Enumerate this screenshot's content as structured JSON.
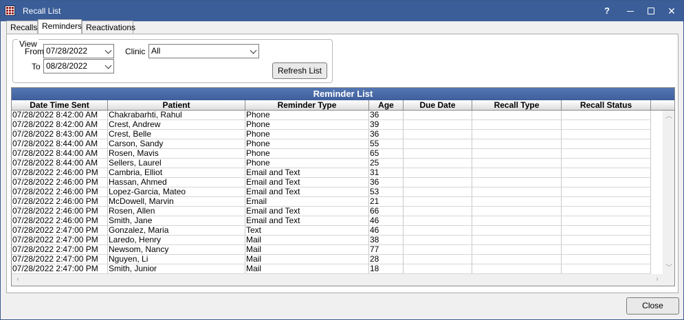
{
  "window": {
    "title": "Recall List",
    "help_label": "?"
  },
  "tabs": [
    {
      "label": "Recalls"
    },
    {
      "label": "Reminders"
    },
    {
      "label": "Reactivations"
    }
  ],
  "view": {
    "legend": "View",
    "from_label": "From",
    "from_value": "07/28/2022",
    "to_label": "To",
    "to_value": "08/28/2022",
    "clinic_label": "Clinic",
    "clinic_value": "All",
    "refresh_label": "Refresh List"
  },
  "grid": {
    "title": "Reminder List",
    "columns": [
      "Date Time Sent",
      "Patient",
      "Reminder Type",
      "Age",
      "Due Date",
      "Recall Type",
      "Recall Status"
    ],
    "rows": [
      [
        "07/28/2022 8:42:00 AM",
        "Chakrabarhti, Rahul",
        "Phone",
        "36",
        "",
        "",
        ""
      ],
      [
        "07/28/2022 8:42:00 AM",
        "Crest, Andrew",
        "Phone",
        "39",
        "",
        "",
        ""
      ],
      [
        "07/28/2022 8:43:00 AM",
        "Crest, Belle",
        "Phone",
        "36",
        "",
        "",
        ""
      ],
      [
        "07/28/2022 8:44:00 AM",
        "Carson, Sandy",
        "Phone",
        "55",
        "",
        "",
        ""
      ],
      [
        "07/28/2022 8:44:00 AM",
        "Rosen, Mavis",
        "Phone",
        "65",
        "",
        "",
        ""
      ],
      [
        "07/28/2022 8:44:00 AM",
        "Sellers, Laurel",
        "Phone",
        "25",
        "",
        "",
        ""
      ],
      [
        "07/28/2022 2:46:00 PM",
        "Cambria, Elliot",
        "Email and Text",
        "31",
        "",
        "",
        ""
      ],
      [
        "07/28/2022 2:46:00 PM",
        "Hassan, Ahmed",
        "Email and Text",
        "36",
        "",
        "",
        ""
      ],
      [
        "07/28/2022 2:46:00 PM",
        "Lopez-Garcia, Mateo",
        "Email and Text",
        "53",
        "",
        "",
        ""
      ],
      [
        "07/28/2022 2:46:00 PM",
        "McDowell, Marvin",
        "Email",
        "21",
        "",
        "",
        ""
      ],
      [
        "07/28/2022 2:46:00 PM",
        "Rosen, Allen",
        "Email and Text",
        "66",
        "",
        "",
        ""
      ],
      [
        "07/28/2022 2:46:00 PM",
        "Smith, Jane",
        "Email and Text",
        "46",
        "",
        "",
        ""
      ],
      [
        "07/28/2022 2:47:00 PM",
        "Gonzalez, Maria",
        "Text",
        "46",
        "",
        "",
        ""
      ],
      [
        "07/28/2022 2:47:00 PM",
        "Laredo, Henry",
        "Mail",
        "38",
        "",
        "",
        ""
      ],
      [
        "07/28/2022 2:47:00 PM",
        "Newsom, Nancy",
        "Mail",
        "77",
        "",
        "",
        ""
      ],
      [
        "07/28/2022 2:47:00 PM",
        "Nguyen, Li",
        "Mail",
        "28",
        "",
        "",
        ""
      ],
      [
        "07/28/2022 2:47:00 PM",
        "Smith, Junior",
        "Mail",
        "18",
        "",
        "",
        ""
      ]
    ]
  },
  "footer": {
    "close_label": "Close"
  },
  "icons": {
    "app": "grid-app-icon",
    "minimize": "minimize-icon",
    "maximize": "maximize-icon",
    "close": "close-icon",
    "dropdown": "chevron-down-icon",
    "scroll_up": "chevron-up-icon",
    "scroll_down": "chevron-down-icon",
    "scroll_left": "chevron-left-icon",
    "scroll_right": "chevron-right-icon"
  },
  "colors": {
    "titlebar": "#3b5e99",
    "grid_title": "#4a6cab"
  }
}
